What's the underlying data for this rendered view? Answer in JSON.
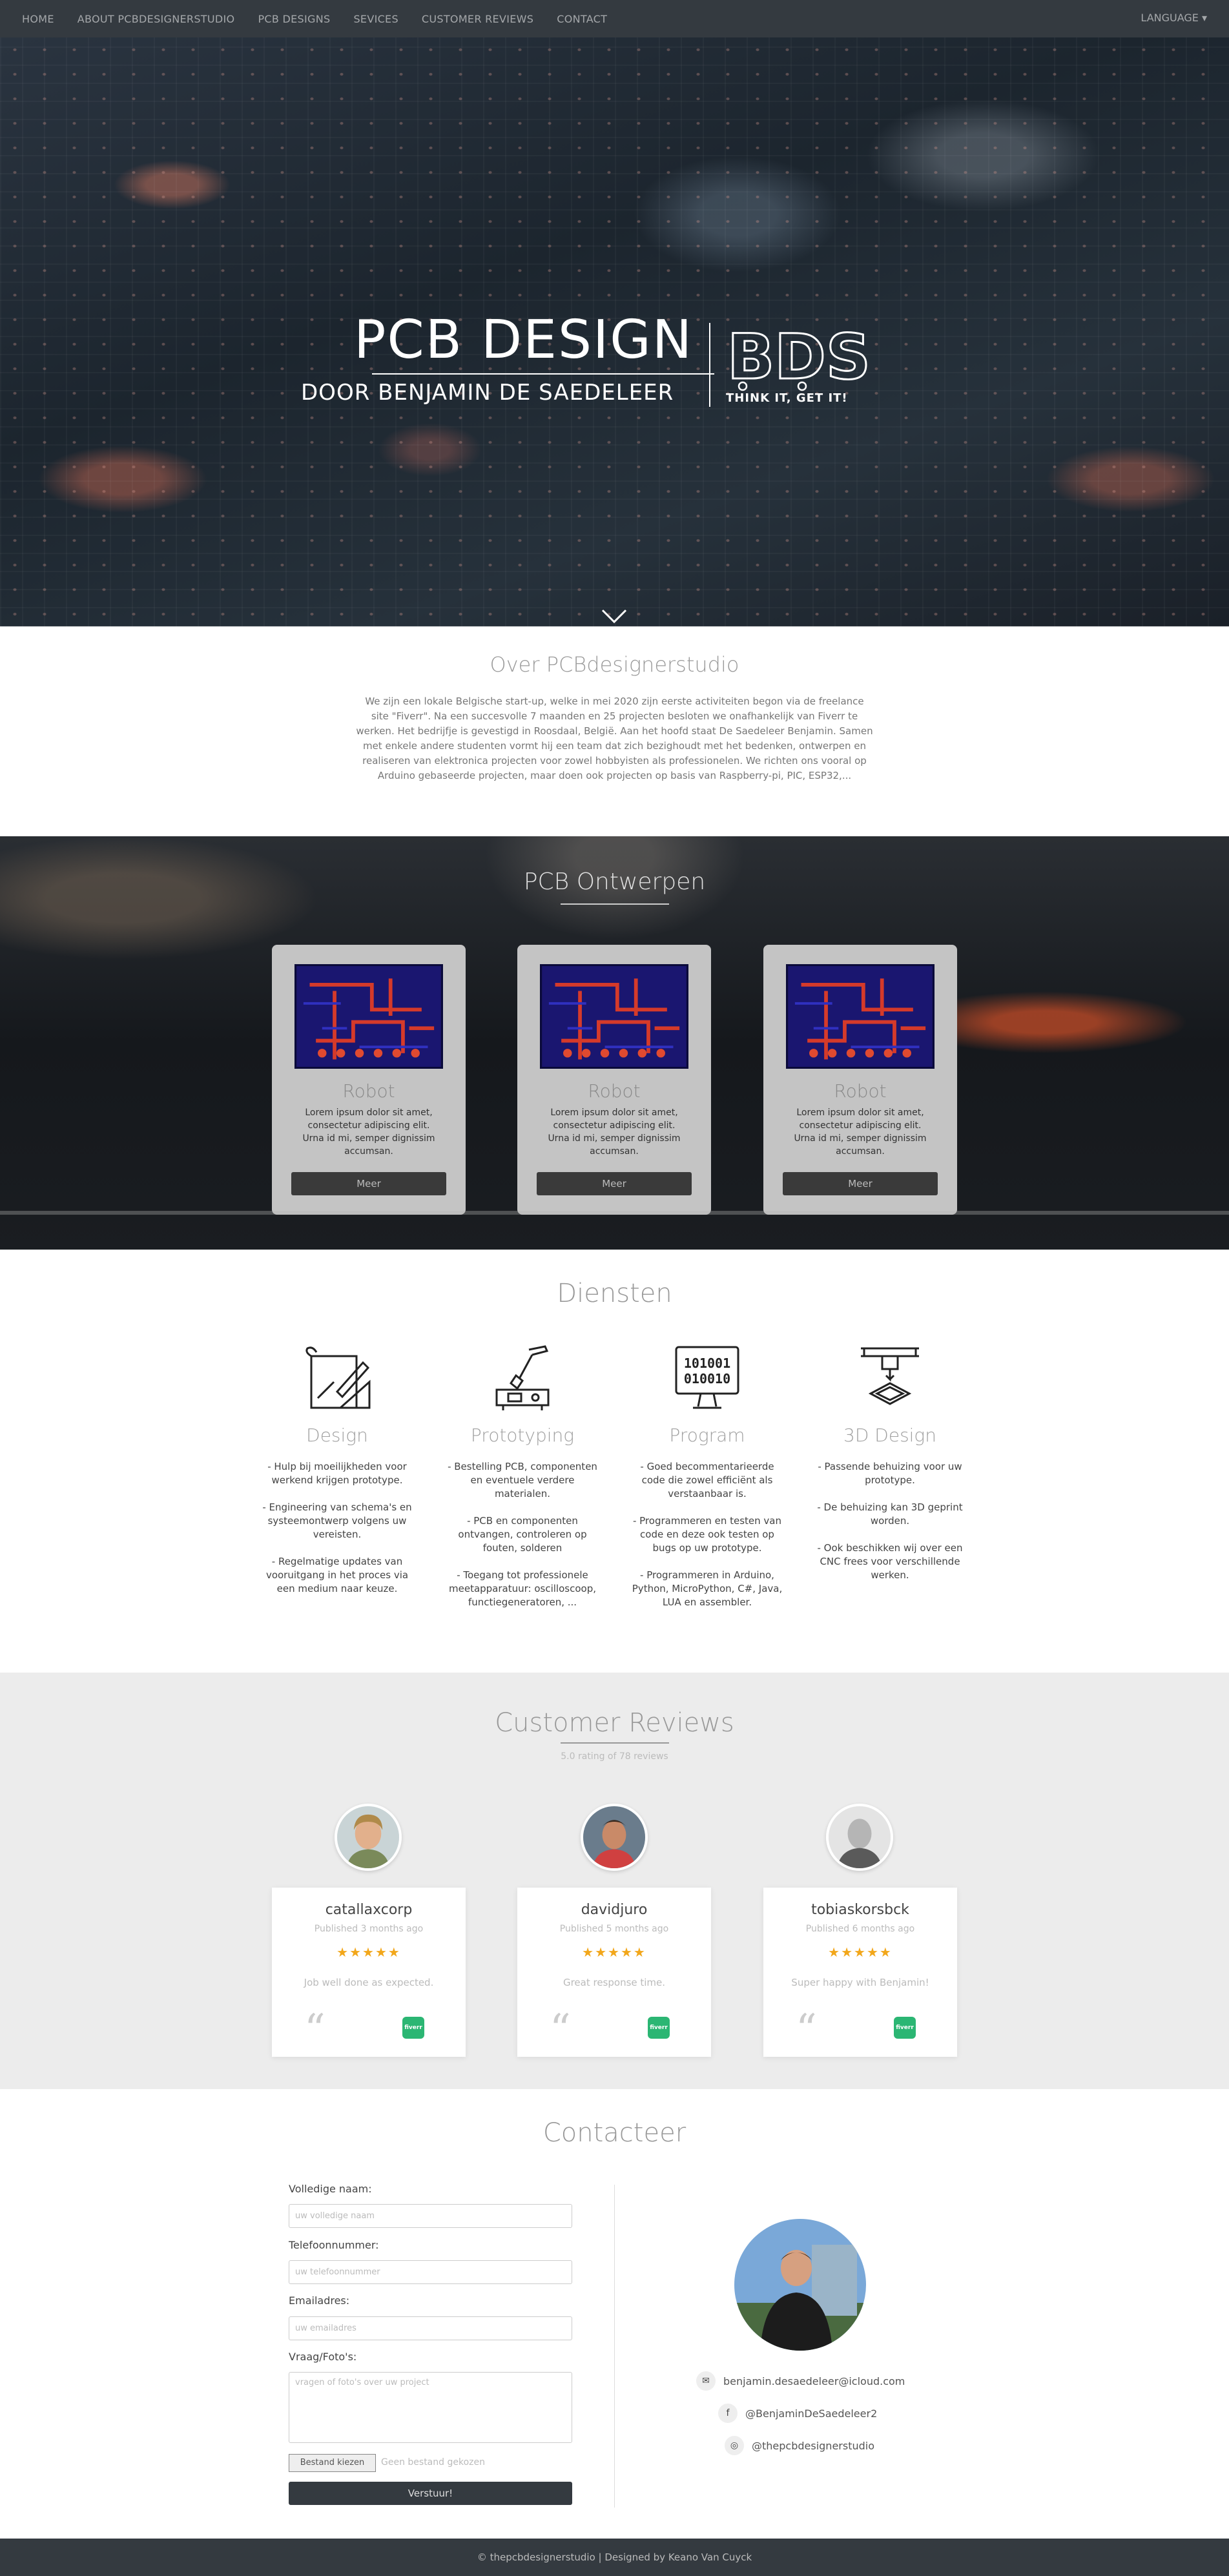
{
  "nav": {
    "items": [
      "HOME",
      "ABOUT PCBDESIGNERSTUDIO",
      "PCB DESIGNS",
      "SEVICES",
      "CUSTOMER REVIEWS",
      "CONTACT"
    ],
    "language": "LANGUAGE ▾"
  },
  "hero": {
    "title": "PCB DESIGN",
    "subtitle": "DOOR BENJAMIN DE SAEDELEER",
    "logo_text": "BDS",
    "logo_tagline": "THINK IT, GET IT!"
  },
  "about": {
    "title": "Over PCBdesignerstudio",
    "text": "We zijn een lokale Belgische start-up, welke in mei 2020 zijn eerste activiteiten begon via de freelance site \"Fiverr\". Na een succesvolle 7 maanden en 25 projecten besloten we onafhankelijk van Fiverr te werken. Het bedrijfje is gevestigd in Roosdaal, België. Aan het hoofd staat De Saedeleer Benjamin. Samen met enkele andere studenten vormt hij een team dat zich bezighoudt met het bedenken, ontwerpen en realiseren van elektronica projecten voor zowel hobbyisten als professionelen. We richten ons vooral op Arduino gebaseerde projecten, maar doen ook projecten op basis van Raspberry-pi, PIC, ESP32,..."
  },
  "pcb": {
    "title": "PCB Ontwerpen",
    "cards": [
      {
        "title": "Robot",
        "text": "Lorem ipsum dolor sit amet, consectetur adipiscing elit. Urna id mi, semper dignissim accumsan.",
        "button": "Meer"
      },
      {
        "title": "Robot",
        "text": "Lorem ipsum dolor sit amet, consectetur adipiscing elit. Urna id mi, semper dignissim accumsan.",
        "button": "Meer"
      },
      {
        "title": "Robot",
        "text": "Lorem ipsum dolor sit amet, consectetur adipiscing elit. Urna id mi, semper dignissim accumsan.",
        "button": "Meer"
      }
    ]
  },
  "services": {
    "title": "Diensten",
    "items": [
      {
        "title": "Design",
        "icon": "drafting-icon",
        "lines": [
          "- Hulp bij moeilijkheden voor werkend krijgen prototype.",
          "- Engineering van schema's en systeemontwerp volgens uw vereisten.",
          "- Regelmatige updates van vooruitgang in het proces via een medium naar keuze."
        ]
      },
      {
        "title": "Prototyping",
        "icon": "soldering-icon",
        "lines": [
          "- Bestelling PCB, componenten en eventuele verdere materialen.",
          "- PCB en componenten ontvangen, controleren op fouten, solderen",
          "- Toegang tot professionele meetapparatuur: oscilloscoop, functiegeneratoren, ..."
        ]
      },
      {
        "title": "Program",
        "icon": "binary-monitor-icon",
        "lines": [
          "- Goed becommentarieerde code die zowel efficiënt als verstaanbaar is.",
          "- Programmeren en testen van code en deze ook testen op bugs op uw prototype.",
          "- Programmeren in Arduino, Python, MicroPython, C#, Java, LUA en assembler."
        ]
      },
      {
        "title": "3D Design",
        "icon": "3d-printer-icon",
        "lines": [
          "- Passende behuizing voor uw prototype.",
          "- De behuizing kan 3D geprint worden.",
          "- Ook beschikken wij over een CNC frees voor verschillende werken."
        ]
      }
    ]
  },
  "reviews": {
    "title": "Customer Reviews",
    "subtitle": "5.0 rating of 78 reviews",
    "items": [
      {
        "name": "catallaxcorp",
        "published": "Published 3 months ago",
        "stars": "★★★★★",
        "text": "Job well done as expected.",
        "badge": "fiverr"
      },
      {
        "name": "davidjuro",
        "published": "Published 5 months ago",
        "stars": "★★★★★",
        "text": "Great response time.",
        "badge": "fiverr"
      },
      {
        "name": "tobiaskorsbck",
        "published": "Published 6 months ago",
        "stars": "★★★★★",
        "text": "Super happy with Benjamin!",
        "badge": "fiverr"
      }
    ]
  },
  "contact": {
    "title": "Contacteer",
    "fields": [
      {
        "label": "Volledige naam:",
        "placeholder": "uw volledige naam"
      },
      {
        "label": "Telefoonnummer:",
        "placeholder": "uw telefoonnummer"
      },
      {
        "label": "Emailadres:",
        "placeholder": "uw emailadres"
      },
      {
        "label": "Vraag/Foto's:",
        "placeholder": "vragen of foto's over uw project"
      }
    ],
    "file_button": "Bestand kiezen",
    "file_text": "Geen bestand gekozen",
    "submit": "Verstuur!",
    "email": "benjamin.desaedeleer@icloud.com",
    "facebook": "@BenjaminDeSaedeleer2",
    "instagram": "@thepcbdesignerstudio"
  },
  "footer": {
    "text": "© thepcbdesignerstudio | Designed by Keano Van Cuyck"
  }
}
